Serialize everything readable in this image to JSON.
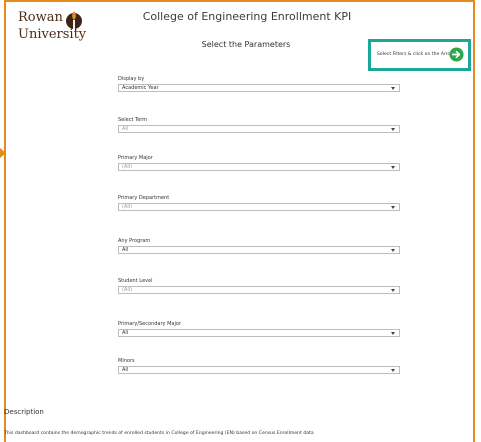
{
  "brand": {
    "logo_line1": "Rowan",
    "logo_line2": "University",
    "accent": "#e58a1f",
    "filter_box_color": "#1aa79a",
    "arrow_color": "#2aa84a"
  },
  "header": {
    "title": "College of Engineering Enrollment KPI",
    "subtitle": "Select the Parameters",
    "filter_hint": "Select Filters & click on the Arrow"
  },
  "filters": [
    {
      "label": "Display by",
      "value": "Academic Year",
      "muted": false
    },
    {
      "label": "Select Term",
      "value": "All",
      "muted": true
    },
    {
      "label": "Primary Major",
      "value": "(All)",
      "muted": true
    },
    {
      "label": "Primary Department",
      "value": "(All)",
      "muted": true
    },
    {
      "label": "Any Program",
      "value": "All",
      "muted": false
    },
    {
      "label": "Student Level",
      "value": "(All)",
      "muted": true
    },
    {
      "label": "Primary/Secondary Major",
      "value": "All",
      "muted": false
    },
    {
      "label": "Minors",
      "value": "All",
      "muted": false
    }
  ],
  "description": {
    "heading": "Description",
    "text": "This dashboard contains the demographic trends of enrolled students  in College of Engineering (EN) based on Census Enrollment data"
  }
}
